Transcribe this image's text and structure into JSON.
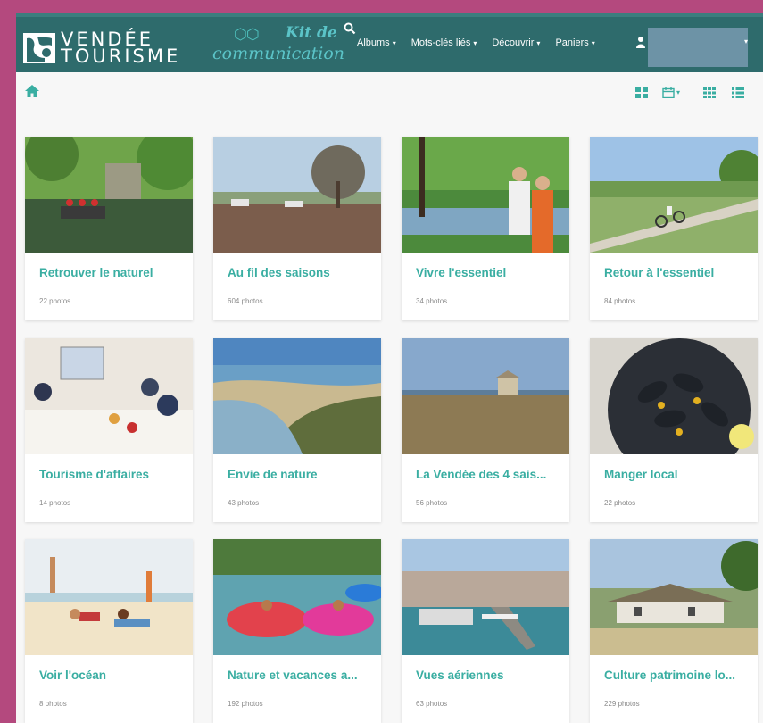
{
  "brand": {
    "line1": "VENDÉE",
    "line2": "TOURISME",
    "kit_title": "Kit de",
    "kit_subtitle": "communication"
  },
  "nav": {
    "items": [
      {
        "label": "Albums"
      },
      {
        "label": "Mots-clés liés"
      },
      {
        "label": "Découvrir"
      },
      {
        "label": "Paniers"
      }
    ],
    "caret": "▾"
  },
  "colors": {
    "navbar": "#2e6b6c",
    "accent_title": "#3aaea2",
    "page_bg": "#f7f7f7",
    "frame": "#b4497e"
  },
  "albums": [
    {
      "title": "Retrouver le naturel",
      "count": "22 photos",
      "icon": "river-canoe-photo"
    },
    {
      "title": "Au fil des saisons",
      "count": "604 photos",
      "icon": "campsite-photo"
    },
    {
      "title": "Vivre l'essentiel",
      "count": "34 photos",
      "icon": "couple-lake-photo"
    },
    {
      "title": "Retour à l'essentiel",
      "count": "84 photos",
      "icon": "cycling-path-photo"
    },
    {
      "title": "Tourisme d'affaires",
      "count": "14 photos",
      "icon": "meeting-room-photo"
    },
    {
      "title": "Envie de nature",
      "count": "43 photos",
      "icon": "estuary-aerial-photo"
    },
    {
      "title": "La Vendée des 4 sais...",
      "count": "56 photos",
      "icon": "coastal-chapel-photo"
    },
    {
      "title": "Manger local",
      "count": "22 photos",
      "icon": "mussels-photo"
    },
    {
      "title": "Voir l'océan",
      "count": "8 photos",
      "icon": "beach-family-photo"
    },
    {
      "title": "Nature et vacances a...",
      "count": "192 photos",
      "icon": "water-park-photo"
    },
    {
      "title": "Vues aériennes",
      "count": "63 photos",
      "icon": "harbour-aerial-photo"
    },
    {
      "title": "Culture patrimoine lo...",
      "count": "229 photos",
      "icon": "thatched-cottage-photo"
    }
  ]
}
